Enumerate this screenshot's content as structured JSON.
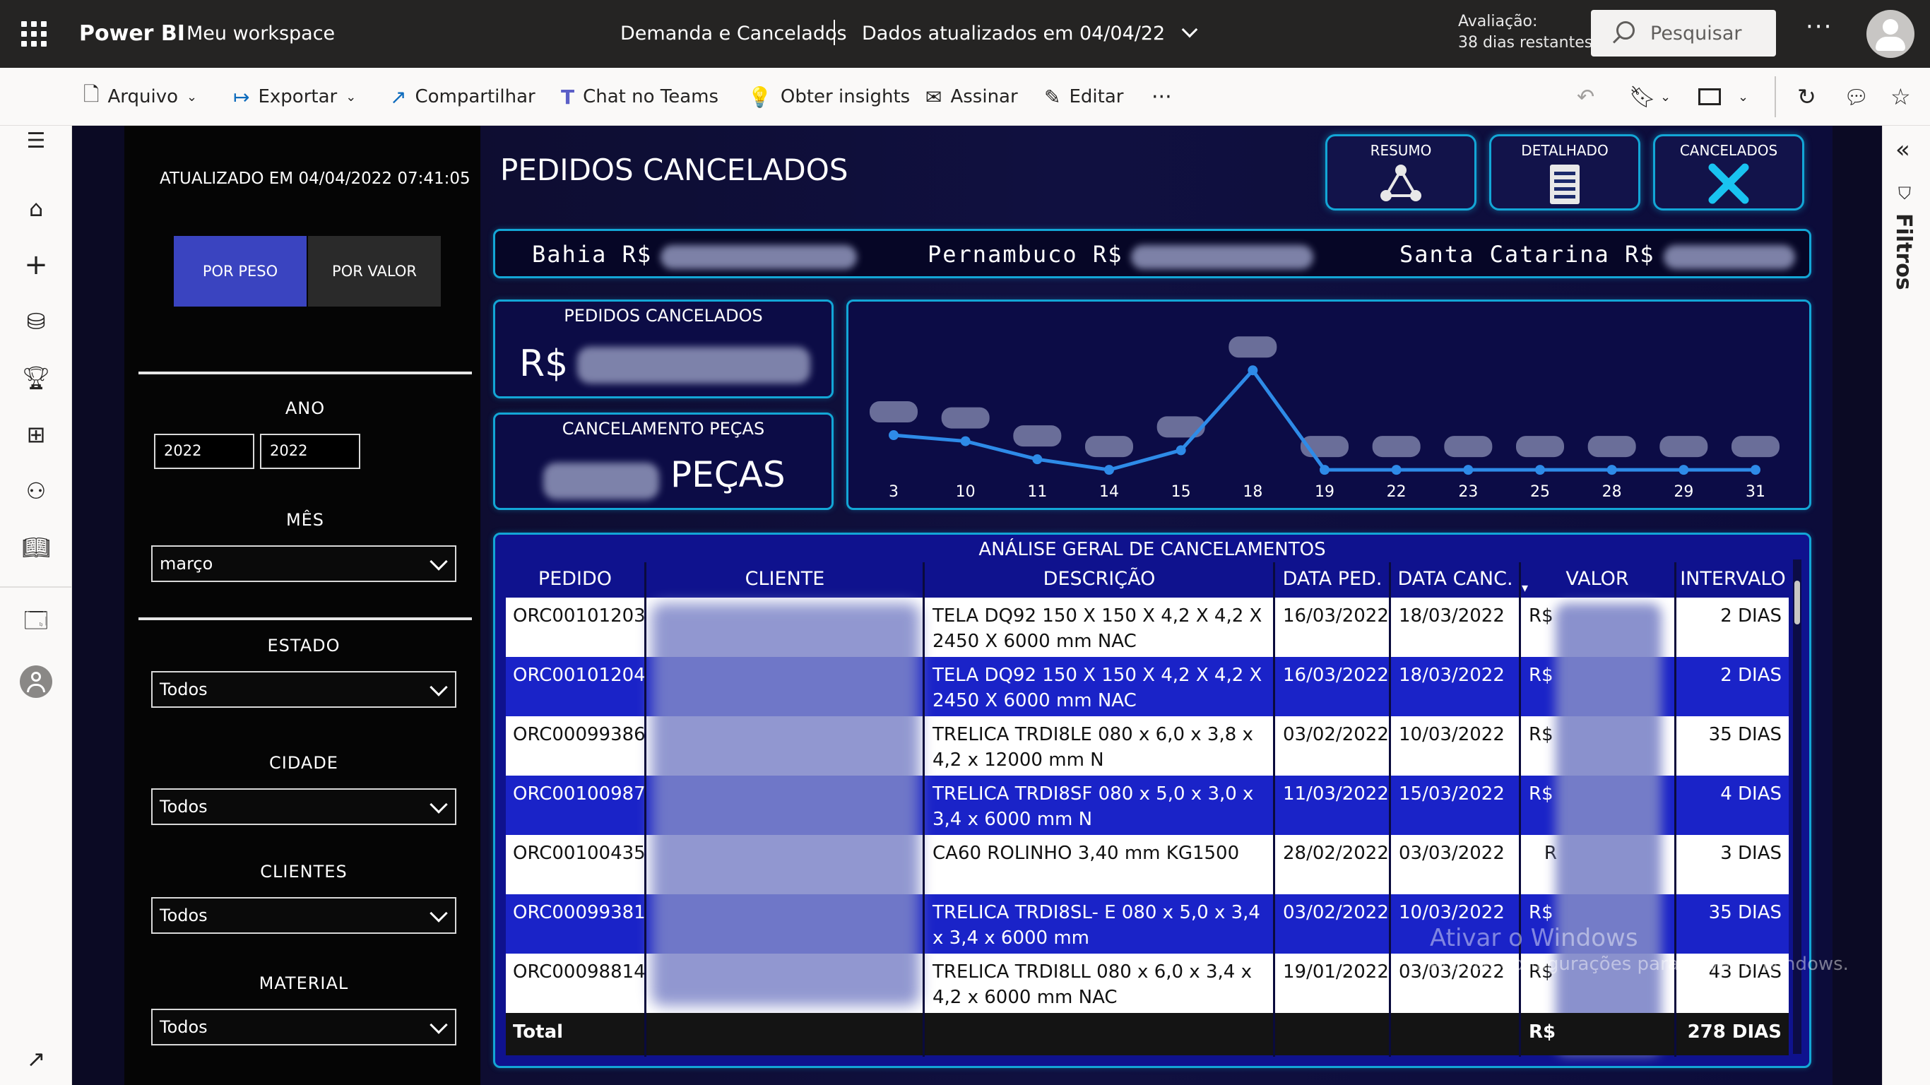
{
  "app": {
    "brand": "Power BI",
    "workspace": "Meu workspace",
    "report_title": "Demanda e Cancelados",
    "data_updated": "Dados atualizados em 04/04/22",
    "trial_line1": "Avaliação:",
    "trial_line2": "38 dias restantes",
    "search_placeholder": "Pesquisar"
  },
  "commands": {
    "arquivo": "Arquivo",
    "exportar": "Exportar",
    "compartilhar": "Compartilhar",
    "chat_teams": "Chat no Teams",
    "insights": "Obter insights",
    "assinar": "Assinar",
    "editar": "Editar"
  },
  "filters_pane": {
    "label": "Filtros"
  },
  "report": {
    "updated_at": "ATUALIZADO EM 04/04/2022 07:41:05",
    "page_title": "PEDIDOS CANCELADOS",
    "toggle": {
      "por_peso": "POR PESO",
      "por_valor": "POR VALOR"
    },
    "nav_buttons": {
      "resumo": "RESUMO",
      "detalhado": "DETALHADO",
      "cancelados": "CANCELADOS"
    },
    "slicers": {
      "ano_label": "ANO",
      "ano_from": "2022",
      "ano_to": "2022",
      "mes_label": "MÊS",
      "mes_value": "março",
      "estado_label": "ESTADO",
      "estado_value": "Todos",
      "cidade_label": "CIDADE",
      "cidade_value": "Todos",
      "clientes_label": "CLIENTES",
      "clientes_value": "Todos",
      "material_label": "MATERIAL",
      "material_value": "Todos"
    },
    "states_banner": {
      "bahia": "Bahia R$",
      "pernambuco": "Pernambuco R$",
      "santa_catarina": "Santa Catarina R$"
    },
    "kpi_pedidos": {
      "title": "PEDIDOS CANCELADOS",
      "prefix": "R$"
    },
    "kpi_pecas": {
      "title": "CANCELAMENTO PEÇAS",
      "suffix": "PEÇAS"
    },
    "table": {
      "title": "ANÁLISE GERAL DE CANCELAMENTOS",
      "headers": [
        "PEDIDO",
        "CLIENTE",
        "DESCRIÇÃO",
        "DATA PED.",
        "DATA CANC.",
        "VALOR",
        "INTERVALO"
      ],
      "rows": [
        {
          "pedido": "ORC00101203",
          "descricao": "TELA DQ92 150 X 150 X 4,2 X 4,2 X 2450 X 6000 mm NAC",
          "data_ped": "16/03/2022",
          "data_canc": "18/03/2022",
          "valor": "R$",
          "intervalo": "2 DIAS"
        },
        {
          "pedido": "ORC00101204",
          "descricao": "TELA DQ92 150 X 150 X 4,2 X 4,2 X 2450 X 6000 mm NAC",
          "data_ped": "16/03/2022",
          "data_canc": "18/03/2022",
          "valor": "R$",
          "intervalo": "2 DIAS"
        },
        {
          "pedido": "ORC00099386",
          "descricao": "TRELICA TRDI8LE 080 x 6,0 x 3,8 x 4,2 x 12000 mm N",
          "data_ped": "03/02/2022",
          "data_canc": "10/03/2022",
          "valor": "R$",
          "intervalo": "35 DIAS"
        },
        {
          "pedido": "ORC00100987",
          "descricao": "TRELICA TRDI8SF 080 x 5,0 x 3,0 x 3,4 x 6000 mm N",
          "data_ped": "11/03/2022",
          "data_canc": "15/03/2022",
          "valor": "R$",
          "intervalo": "4 DIAS"
        },
        {
          "pedido": "ORC00100435",
          "descricao": "CA60 ROLINHO 3,40 mm KG1500",
          "data_ped": "28/02/2022",
          "data_canc": "03/03/2022",
          "valor": "R",
          "intervalo": "3 DIAS"
        },
        {
          "pedido": "ORC00099381",
          "descricao": "TRELICA TRDI8SL- E 080 x 5,0 x 3,4 x 3,4 x 6000 mm",
          "data_ped": "03/02/2022",
          "data_canc": "10/03/2022",
          "valor": "R$",
          "intervalo": "35 DIAS"
        },
        {
          "pedido": "ORC00098814",
          "descricao": "TRELICA TRDI8LL 080 x 6,0 x 3,4 x 4,2 x 6000 mm NAC",
          "data_ped": "19/01/2022",
          "data_canc": "03/03/2022",
          "valor": "R$",
          "intervalo": "43 DIAS"
        }
      ],
      "total_label": "Total",
      "total_valor": "R$",
      "total_intervalo": "278 DIAS"
    },
    "watermark": {
      "line1": "Ativar o Windows",
      "line2": "Acesse Configurações para ativar o Windows."
    }
  },
  "chart_data": {
    "type": "line",
    "categories": [
      "3",
      "10",
      "11",
      "14",
      "15",
      "18",
      "19",
      "22",
      "23",
      "25",
      "28",
      "29",
      "31"
    ],
    "series": [
      {
        "values": [
          5.2,
          4.8,
          3.6,
          2.9,
          4.2,
          9.5,
          2.9,
          2.9,
          2.9,
          2.9,
          2.9,
          2.9,
          2.9
        ]
      }
    ],
    "data_labels": "blurred",
    "axis_y": "hidden",
    "grid": false,
    "line_color": "#2e8be8"
  }
}
